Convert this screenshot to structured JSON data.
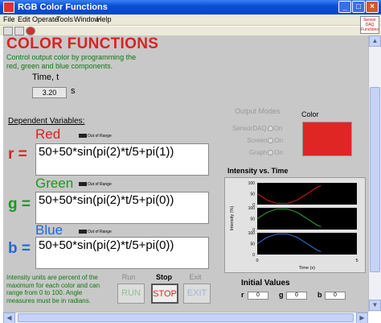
{
  "window": {
    "title": "RGB Color Functions",
    "min": "_",
    "max": "□",
    "close": "×"
  },
  "menu": [
    "File",
    "Edit",
    "Operate",
    "Tools",
    "Window",
    "Help"
  ],
  "logo_text": "Sensor DAQ Functions",
  "heading": "COLOR FUNCTIONS",
  "description": "Control output color by programming the red, green and blue components.",
  "time": {
    "label": "Time, t",
    "value": "3.20",
    "unit": "s"
  },
  "dependent_label": "Dependent Variables:",
  "out_of_range": "Out of Range",
  "channels": [
    {
      "name": "Red",
      "symbol": "r =",
      "formula": "50+50*sin(pi(2)*t/5+pi(1))",
      "color": "#e02020"
    },
    {
      "name": "Green",
      "symbol": "g =",
      "formula": "50+50*sin(pi(2)*t/5+pi(0))",
      "color": "#1a9a1a"
    },
    {
      "name": "Blue",
      "symbol": "b =",
      "formula": "50+50*sin(pi(2)*t/5+pi(0))",
      "color": "#2266dd"
    }
  ],
  "note": "Intensity units are percent of the maximum for each color and can range from 0 to 100. Angle measures must be in radians.",
  "controls": [
    {
      "label": "Run",
      "button": "RUN",
      "label_color": "#888888",
      "text_color": "#8fc28f",
      "active": false
    },
    {
      "label": "Stop",
      "button": "STOP",
      "label_color": "#000000",
      "text_color": "#e02020",
      "active": true
    },
    {
      "label": "Exit",
      "button": "EXIT",
      "label_color": "#888888",
      "text_color": "#9fb4d8",
      "active": false
    }
  ],
  "output_modes": {
    "title": "Output Modes",
    "items": [
      {
        "label": "SensorDAQ",
        "state": "On"
      },
      {
        "label": "Screen",
        "state": "On"
      },
      {
        "label": "Graph",
        "state": "On"
      }
    ]
  },
  "color_label": "Color",
  "color_value": "#e02525",
  "initial_values": {
    "title": "Initial Values",
    "r": "0",
    "g": "0",
    "b": "0",
    "r_label": "r",
    "g_label": "g",
    "b_label": "b"
  },
  "chart_data": {
    "type": "line",
    "title": "Intensity vs. Time",
    "xlabel": "Time (s)",
    "ylabel": "Intensity (%)",
    "xlim": [
      0,
      5
    ],
    "x_ticks": [
      "0",
      "5"
    ],
    "y_ticks": [
      "100",
      "50",
      "0"
    ],
    "panels": [
      {
        "name": "Red",
        "color": "#e02020",
        "x": [
          0,
          0.5,
          1,
          1.5,
          2,
          2.5,
          3,
          3.2
        ],
        "y": [
          50,
          20.6,
          4.9,
          4.9,
          20.6,
          50,
          79.4,
          86.8
        ]
      },
      {
        "name": "Green",
        "color": "#3aa83a",
        "x": [
          0,
          0.5,
          1,
          1.5,
          2,
          2.5,
          3,
          3.2
        ],
        "y": [
          50,
          79.4,
          95.1,
          95.1,
          79.4,
          50,
          20.6,
          13.2
        ]
      },
      {
        "name": "Blue",
        "color": "#3a78e0",
        "x": [
          0,
          0.5,
          1,
          1.5,
          2,
          2.5,
          3,
          3.2
        ],
        "y": [
          50,
          79.4,
          95.1,
          95.1,
          79.4,
          50,
          20.6,
          13.2
        ]
      }
    ]
  }
}
